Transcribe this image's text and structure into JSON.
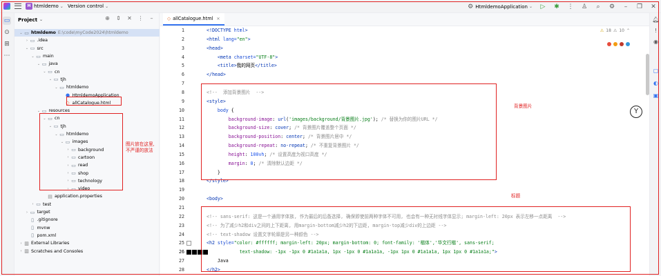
{
  "titlebar": {
    "project_badge": "H",
    "project_name": "htmldemo",
    "vcs": "Version control",
    "run_config": "HtmldemoApplication"
  },
  "project_panel": {
    "title": "Project",
    "tree": [
      {
        "label": "htmldemo",
        "path": "E:\\code\\myCode2024\\htmldemo",
        "depth": 0,
        "type": "folder",
        "open": true,
        "bold": true,
        "selected": true
      },
      {
        "label": ".idea",
        "depth": 1,
        "type": "folder",
        "open": false
      },
      {
        "label": "src",
        "depth": 1,
        "type": "folder",
        "open": true
      },
      {
        "label": "main",
        "depth": 2,
        "type": "folder",
        "open": true
      },
      {
        "label": "java",
        "depth": 3,
        "type": "folder",
        "open": true
      },
      {
        "label": "cn",
        "depth": 4,
        "type": "folder",
        "open": true
      },
      {
        "label": "tjh",
        "depth": 5,
        "type": "folder",
        "open": true
      },
      {
        "label": "htmldemo",
        "depth": 6,
        "type": "folder",
        "open": true
      },
      {
        "label": "HtmldemoApplication",
        "depth": 7,
        "type": "java",
        "leaf": true
      },
      {
        "label": "allCatalogue.html",
        "depth": 7,
        "type": "html",
        "leaf": true
      },
      {
        "label": "resources",
        "depth": 3,
        "type": "folder",
        "open": true
      },
      {
        "label": "cn",
        "depth": 4,
        "type": "folder",
        "open": true
      },
      {
        "label": "tjh",
        "depth": 5,
        "type": "folder",
        "open": true
      },
      {
        "label": "htmldemo",
        "depth": 6,
        "type": "folder",
        "open": true
      },
      {
        "label": "images",
        "depth": 7,
        "type": "folder",
        "open": true
      },
      {
        "label": "background",
        "depth": 8,
        "type": "folder",
        "open": false
      },
      {
        "label": "cartoon",
        "depth": 8,
        "type": "folder",
        "open": false
      },
      {
        "label": "read",
        "depth": 8,
        "type": "folder",
        "open": false
      },
      {
        "label": "shop",
        "depth": 8,
        "type": "folder",
        "open": false
      },
      {
        "label": "technology",
        "depth": 8,
        "type": "folder",
        "open": false
      },
      {
        "label": "video",
        "depth": 8,
        "type": "folder",
        "open": false
      },
      {
        "label": "application.properties",
        "depth": 4,
        "type": "props",
        "leaf": true
      },
      {
        "label": "test",
        "depth": 2,
        "type": "folder",
        "open": false
      },
      {
        "label": "target",
        "depth": 1,
        "type": "folder",
        "open": false
      },
      {
        "label": ".gitignore",
        "depth": 1,
        "type": "file",
        "leaf": true
      },
      {
        "label": "mvnw",
        "depth": 1,
        "type": "file",
        "leaf": true
      },
      {
        "label": "pom.xml",
        "depth": 1,
        "type": "file",
        "leaf": true
      },
      {
        "label": "External Libraries",
        "depth": 0,
        "type": "lib",
        "open": false
      },
      {
        "label": "Scratches and Consoles",
        "depth": 0,
        "type": "lib",
        "open": false
      }
    ],
    "note": [
      "图片放在这里,",
      "不严谨的放法"
    ]
  },
  "editor": {
    "tab_label": "allCatalogue.html",
    "inspection": {
      "warnings": "18",
      "weak": "10"
    },
    "note_background": "背景图片",
    "note_title": "标题",
    "line_numbers": [
      "1",
      "2",
      "3",
      "4",
      "5",
      "6",
      "7",
      "8",
      "9",
      "10",
      "11",
      "12",
      "13",
      "14",
      "15",
      "16",
      "17",
      "18",
      "19",
      "20",
      "21",
      "22",
      "23",
      "24",
      "25",
      "26",
      "27",
      "28"
    ],
    "lines": [
      [
        [
          "tag",
          "<!DOCTYPE "
        ],
        [
          "attr",
          "html"
        ],
        [
          "tag",
          ">"
        ]
      ],
      [
        [
          "tag",
          "<html "
        ],
        [
          "attr",
          "lang="
        ],
        [
          "str",
          "\"en\""
        ],
        [
          "tag",
          ">"
        ]
      ],
      [
        [
          "tag",
          "<head>"
        ]
      ],
      [
        [
          "plain",
          "    "
        ],
        [
          "tag",
          "<meta "
        ],
        [
          "attr",
          "charset="
        ],
        [
          "str",
          "\"UTF-8\""
        ],
        [
          "tag",
          ">"
        ]
      ],
      [
        [
          "plain",
          "    "
        ],
        [
          "tag",
          "<title>"
        ],
        [
          "plain",
          "我的网页"
        ],
        [
          "tag",
          "</title>"
        ]
      ],
      [
        [
          "tag",
          "</head>"
        ]
      ],
      [],
      [
        [
          "cmt",
          "<!--  添加背景图片  -->"
        ]
      ],
      [
        [
          "tag",
          "<style>"
        ]
      ],
      [
        [
          "plain",
          "    "
        ],
        [
          "sel",
          "body"
        ],
        [
          "plain",
          " {"
        ]
      ],
      [
        [
          "plain",
          "        "
        ],
        [
          "prop",
          "background-image"
        ],
        [
          "plain",
          ": "
        ],
        [
          "kw",
          "url"
        ],
        [
          "plain",
          "("
        ],
        [
          "str",
          "'images/background/背景图片.jpg'"
        ],
        [
          "plain",
          "); "
        ],
        [
          "cmt",
          "/* 替换为你的图片URL */"
        ]
      ],
      [
        [
          "plain",
          "        "
        ],
        [
          "prop",
          "background-size"
        ],
        [
          "plain",
          ": "
        ],
        [
          "kw",
          "cover"
        ],
        [
          "plain",
          "; "
        ],
        [
          "cmt",
          "/* 背景图片覆盖整个页面 */"
        ]
      ],
      [
        [
          "plain",
          "        "
        ],
        [
          "prop",
          "background-position"
        ],
        [
          "plain",
          ": "
        ],
        [
          "kw",
          "center"
        ],
        [
          "plain",
          "; "
        ],
        [
          "cmt",
          "/* 背景图片居中 */"
        ]
      ],
      [
        [
          "plain",
          "        "
        ],
        [
          "prop",
          "background-repeat"
        ],
        [
          "plain",
          ": "
        ],
        [
          "kw",
          "no-repeat"
        ],
        [
          "plain",
          "; "
        ],
        [
          "cmt",
          "/* 不重复背景图片 */"
        ]
      ],
      [
        [
          "plain",
          "        "
        ],
        [
          "prop",
          "height"
        ],
        [
          "plain",
          ": "
        ],
        [
          "num",
          "100vh"
        ],
        [
          "plain",
          "; "
        ],
        [
          "cmt",
          "/* 设置高度为视口高度 */"
        ]
      ],
      [
        [
          "plain",
          "        "
        ],
        [
          "prop",
          "margin"
        ],
        [
          "plain",
          ": "
        ],
        [
          "num",
          "0"
        ],
        [
          "plain",
          "; "
        ],
        [
          "cmt",
          "/* 清除默认边距 */"
        ]
      ],
      [
        [
          "plain",
          "    }"
        ]
      ],
      [
        [
          "tag",
          "</style>"
        ]
      ],
      [],
      [
        [
          "tag",
          "<body>"
        ]
      ],
      [],
      [
        [
          "cmt",
          "<!-- sans-serif: 这是一个通用字体族, 作为最后的后备选择, 确保即使前两种字体不可用, 也会有一种无衬线字体显示; margin-left: 20px 表示左移一点距离  -->"
        ]
      ],
      [
        [
          "cmt",
          "<!-- 为了减少h2和div之间的上下距离, 用margin-bottom减少h2的下边距, margin-top减少div的上边距 -->"
        ]
      ],
      [
        [
          "cmt",
          "<!-- text-shadow 设置文字轮廓是另一种颜色 -->"
        ]
      ],
      [
        [
          "tag",
          "<h2 "
        ],
        [
          "attr",
          "style="
        ],
        [
          "str",
          "\"color: #ffffff; margin-left: 20px; margin-bottom: 0; font-family: '楷体','华文行楷', sans-serif;"
        ]
      ],
      [
        [
          "str",
          "            text-shadow: -1px -1px 0 #1a1a1a, 1px -1px 0 #1a1a1a, -1px 1px 0 #1a1a1a, 1px 1px 0 #1a1a1a;\""
        ],
        [
          "tag",
          ">"
        ]
      ],
      [
        [
          "plain",
          "    Java"
        ]
      ],
      [
        [
          "tag",
          "</h2>"
        ]
      ]
    ]
  }
}
